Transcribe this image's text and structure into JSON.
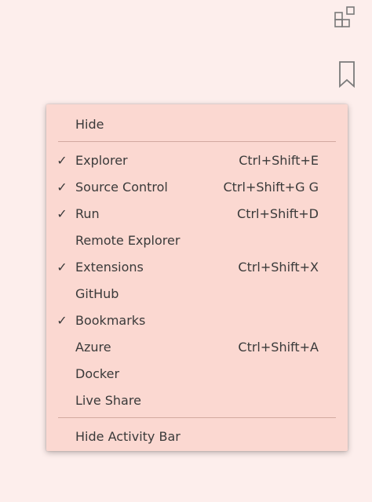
{
  "activity_bar": {
    "icons": [
      {
        "name": "extensions-icon"
      },
      {
        "name": "bookmark-icon"
      }
    ]
  },
  "context_menu": {
    "group1": [
      {
        "label": "Hide",
        "shortcut": "",
        "checked": false
      }
    ],
    "group2": [
      {
        "label": "Explorer",
        "shortcut": "Ctrl+Shift+E",
        "checked": true
      },
      {
        "label": "Source Control",
        "shortcut": "Ctrl+Shift+G G",
        "checked": true
      },
      {
        "label": "Run",
        "shortcut": "Ctrl+Shift+D",
        "checked": true
      },
      {
        "label": "Remote Explorer",
        "shortcut": "",
        "checked": false
      },
      {
        "label": "Extensions",
        "shortcut": "Ctrl+Shift+X",
        "checked": true
      },
      {
        "label": "GitHub",
        "shortcut": "",
        "checked": false
      },
      {
        "label": "Bookmarks",
        "shortcut": "",
        "checked": true
      },
      {
        "label": "Azure",
        "shortcut": "Ctrl+Shift+A",
        "checked": false
      },
      {
        "label": "Docker",
        "shortcut": "",
        "checked": false
      },
      {
        "label": "Live Share",
        "shortcut": "",
        "checked": false
      }
    ],
    "group3": [
      {
        "label": "Hide Activity Bar",
        "shortcut": "",
        "checked": false
      }
    ],
    "check_glyph": "✓"
  },
  "colors": {
    "background": "#fdeeec",
    "menu_background": "#fbd8d1",
    "text": "#3a3a3a",
    "icon": "#7a7a7a",
    "separator": "#d2a9a0"
  }
}
